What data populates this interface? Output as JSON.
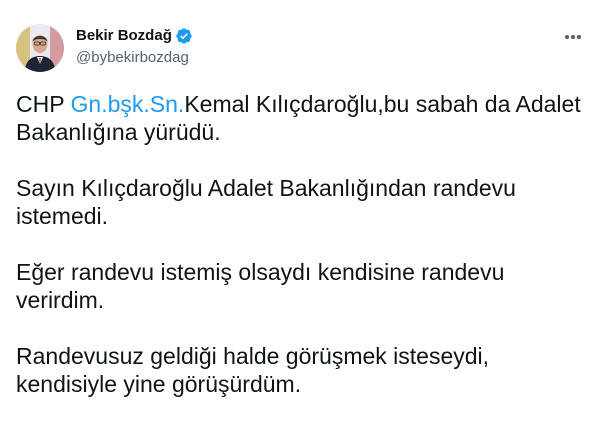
{
  "author": {
    "display_name": "Bekir Bozdağ",
    "handle": "@bybekirbozdag",
    "verified": true
  },
  "menu": {
    "icon": "more-horizontal-icon"
  },
  "tweet": {
    "p1_pre": "CHP ",
    "p1_link": "Gn.bşk.Sn.",
    "p1_rest": "Kemal Kılıçdaroğlu,bu sabah da Adalet Bakanlığına yürüdü.",
    "p2": "Sayın Kılıçdaroğlu Adalet Bakanlığından randevu istemedi.",
    "p3": "Eğer randevu istemiş olsaydı kendisine randevu verirdim.",
    "p4": "Randevusuz geldiği halde görüşmek isteseydi, kendisiyle yine görüşürdüm."
  },
  "colors": {
    "link": "#1d9bf0",
    "verified": "#1d9bf0",
    "text": "#0f1419",
    "secondary": "#536471"
  }
}
